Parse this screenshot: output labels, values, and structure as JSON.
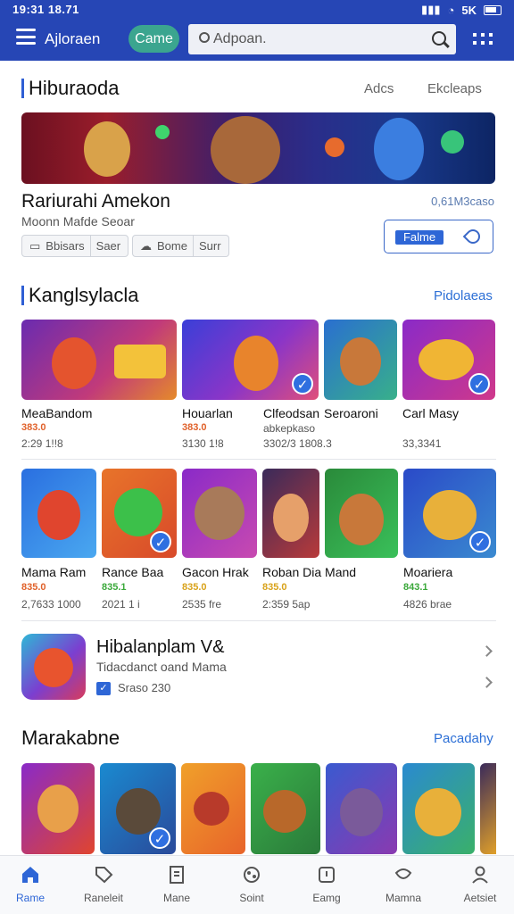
{
  "status": {
    "time": "19:31 18.71",
    "right": "5K"
  },
  "header": {
    "title": "Ajloraen",
    "pill": "Came",
    "search_placeholder": "Adpoan."
  },
  "section1": {
    "title": "Hiburaoda",
    "link_a": "Adcs",
    "link_b": "Ekcleaps"
  },
  "featured": {
    "name": "Rariurahi Amekon",
    "subtitle": "Moonn Mafde Seoar",
    "meta": "0,61M3caso",
    "chip1_label": "Bbisars",
    "chip1_value": "Saer",
    "chip2_label": "Bome",
    "chip2_value": "Surr",
    "button_label": "Falme"
  },
  "section2": {
    "title": "Kanglsylacla",
    "link": "Pidolaeas",
    "row1": [
      {
        "name": "MeaBandom",
        "rating": "383.0",
        "sub": "2:29 1!!8"
      },
      {
        "name": "Houarlan",
        "rating": "383.0",
        "sub": "3130 1!8"
      },
      {
        "name": "Clfeodsan",
        "rating": "",
        "sub": "abkepkaso"
      },
      {
        "name": "Seroaroni",
        "rating": "",
        "sub": "3302/3 1808.3"
      },
      {
        "name": "Carl Masy",
        "rating": "",
        "sub": "33,3341"
      }
    ],
    "row2": [
      {
        "name": "Mama Ram",
        "rating": "835.0",
        "sub": "2,7633 1000"
      },
      {
        "name": "Rance Baa",
        "rating": "835.1",
        "sub": "2021 1 i"
      },
      {
        "name": "Gacon Hrak",
        "rating": "835.0",
        "sub": "2535 fre"
      },
      {
        "name": "Roban Dia Mand",
        "rating": "835.0",
        "sub": "2:359 5ap"
      },
      {
        "name": "Moariera",
        "rating": "843.1",
        "sub": "4826 brae"
      }
    ]
  },
  "promo": {
    "title": "Hibalanplam V&",
    "subtitle": "Tidacdanct oand Mama",
    "meta": "Sraso 230"
  },
  "section3": {
    "title": "Marakabne",
    "link": "Pacadahy"
  },
  "bottom_nav": [
    {
      "label": "Rame",
      "icon": "home-icon"
    },
    {
      "label": "Raneleit",
      "icon": "tag-icon"
    },
    {
      "label": "Mane",
      "icon": "document-icon"
    },
    {
      "label": "Soint",
      "icon": "game-icon"
    },
    {
      "label": "Eamg",
      "icon": "shield-icon"
    },
    {
      "label": "Mamna",
      "icon": "chat-icon"
    },
    {
      "label": "Aetsiet",
      "icon": "profile-icon"
    }
  ],
  "colors": {
    "accent": "#2646b5",
    "link": "#2c6fd6",
    "pill": "#3ba58f",
    "rating": "#e0612a"
  }
}
